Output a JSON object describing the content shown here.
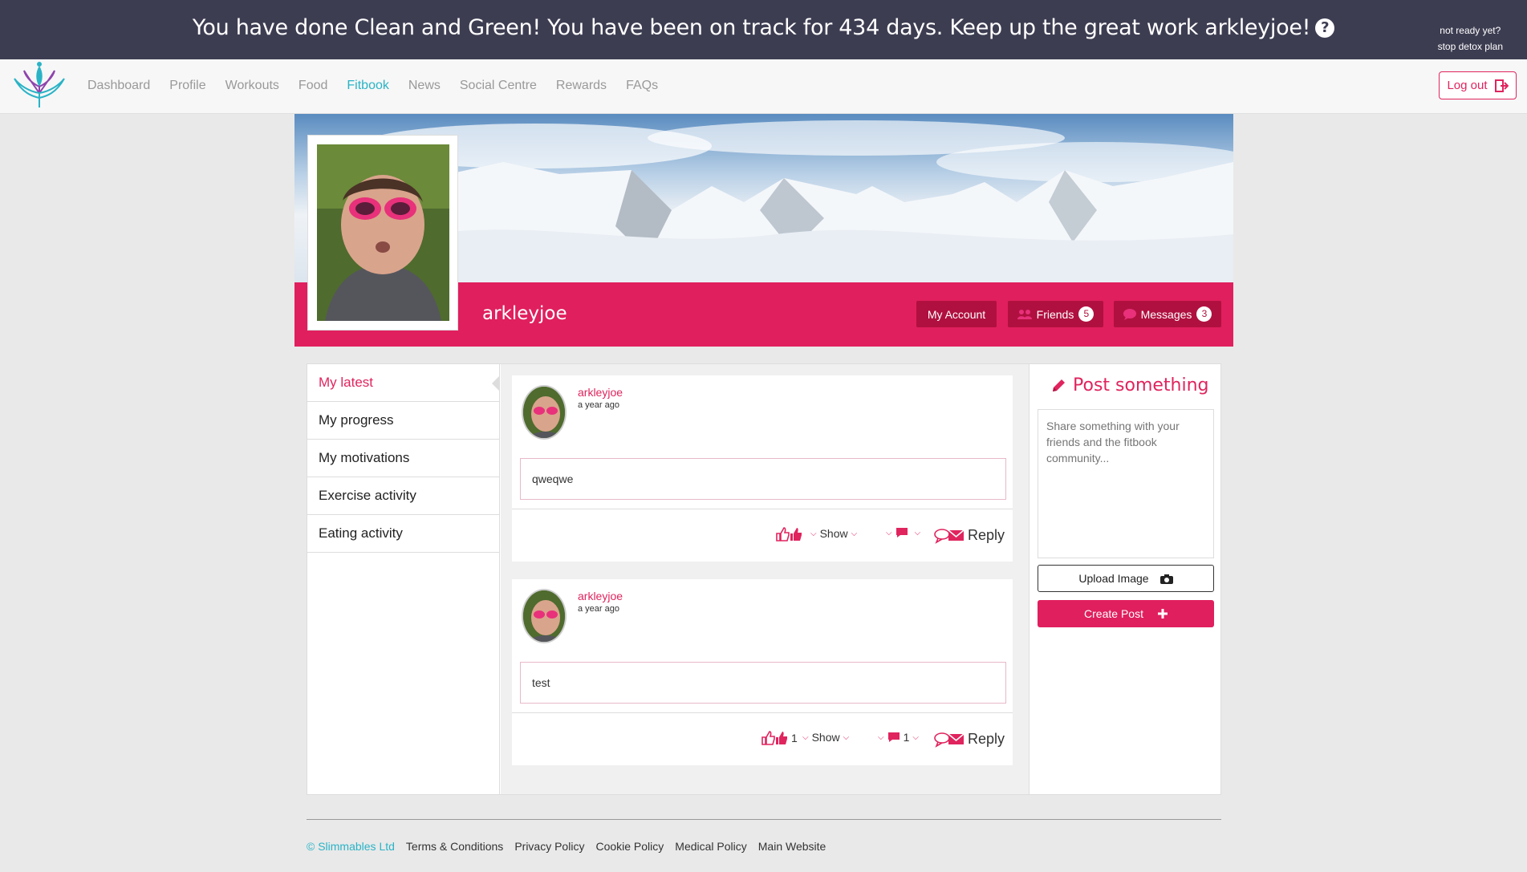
{
  "banner": {
    "message": "You have done Clean and Green! You have been on track for 434 days. Keep up the great work arkleyjoe!",
    "help_glyph": "?",
    "stop_line1": "not ready yet?",
    "stop_line2": "stop detox plan"
  },
  "nav": {
    "items": [
      {
        "label": "Dashboard"
      },
      {
        "label": "Profile"
      },
      {
        "label": "Workouts"
      },
      {
        "label": "Food"
      },
      {
        "label": "Fitbook"
      },
      {
        "label": "News"
      },
      {
        "label": "Social Centre"
      },
      {
        "label": "Rewards"
      },
      {
        "label": "FAQs"
      }
    ],
    "active": "Fitbook",
    "logout_label": "Log out"
  },
  "profile": {
    "name": "arkleyjoe",
    "my_account_label": "My Account",
    "friends_label": "Friends",
    "friends_count": "5",
    "messages_label": "Messages",
    "messages_count": "3"
  },
  "sidebar": {
    "items": [
      {
        "label": "My latest"
      },
      {
        "label": "My progress"
      },
      {
        "label": "My motivations"
      },
      {
        "label": "Exercise activity"
      },
      {
        "label": "Eating activity"
      }
    ],
    "active": "My latest"
  },
  "posts": [
    {
      "user": "arkleyjoe",
      "time": "a year ago",
      "body": "qweqwe",
      "likes": "",
      "show_label": "Show",
      "comments": "",
      "reply_label": "Reply"
    },
    {
      "user": "arkleyjoe",
      "time": "a year ago",
      "body": "test",
      "likes": "1",
      "show_label": "Show",
      "comments": "1",
      "reply_label": "Reply"
    }
  ],
  "compose": {
    "title": "Post something",
    "placeholder": "Share something with your friends and the fitbook community...",
    "upload_label": "Upload Image",
    "create_label": "Create Post"
  },
  "footer": {
    "copyright": "© Slimmables Ltd",
    "links": [
      {
        "label": "Terms & Conditions"
      },
      {
        "label": "Privacy Policy"
      },
      {
        "label": "Cookie Policy"
      },
      {
        "label": "Medical Policy"
      },
      {
        "label": "Main Website"
      }
    ]
  },
  "colors": {
    "accent": "#e01f5e",
    "banner_bg": "#3d3d52",
    "nav_active": "#2ab3c6"
  }
}
